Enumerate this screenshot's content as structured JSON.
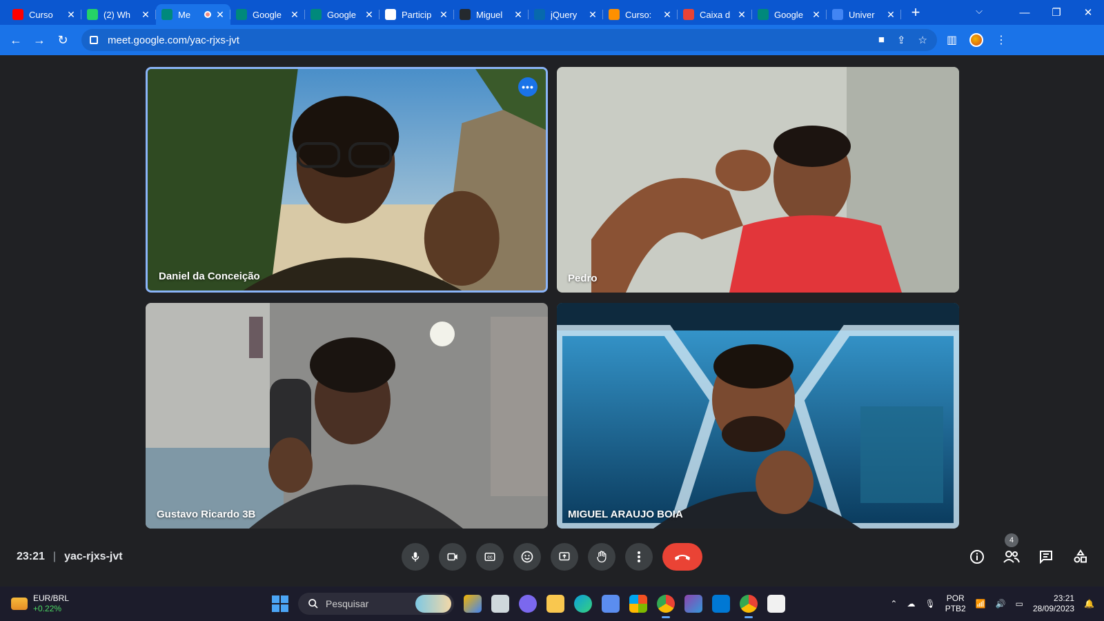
{
  "browser": {
    "tabs": [
      {
        "title": "Curso",
        "icon": "youtube-icon",
        "color": "#ff0000"
      },
      {
        "title": "(2) Wh",
        "icon": "whatsapp-icon",
        "color": "#25d366"
      },
      {
        "title": "Me",
        "icon": "google-meet-icon",
        "color": "#00897b",
        "active": true,
        "recording": true
      },
      {
        "title": "Google",
        "icon": "google-meet-icon",
        "color": "#00897b"
      },
      {
        "title": "Google",
        "icon": "google-meet-icon",
        "color": "#00897b"
      },
      {
        "title": "Particip",
        "icon": "google-icon",
        "color": "#ffffff"
      },
      {
        "title": "Miguel",
        "icon": "github-icon",
        "color": "#24292e"
      },
      {
        "title": "jQuery",
        "icon": "jquery-icon",
        "color": "#0769ad"
      },
      {
        "title": "Curso:",
        "icon": "rocketseat-icon",
        "color": "#ff9000"
      },
      {
        "title": "Caixa d",
        "icon": "gmail-icon",
        "color": "#ea4335"
      },
      {
        "title": "Google",
        "icon": "google-meet-icon",
        "color": "#00897b"
      },
      {
        "title": "Univer",
        "icon": "calendar-icon",
        "color": "#4285f4"
      }
    ],
    "url": "meet.google.com/yac-rjxs-jvt"
  },
  "meeting": {
    "participants": [
      {
        "name": "Daniel da Conceição"
      },
      {
        "name": "Pedro"
      },
      {
        "name": "Gustavo Ricardo 3B"
      },
      {
        "name": "MIGUEL ARAUJO BOIA"
      }
    ],
    "tile_menu_label": "•••",
    "time": "23:21",
    "separator": "|",
    "code": "yac-rjxs-jvt",
    "participant_count": "4",
    "controls": [
      "microphone-icon",
      "camera-icon",
      "captions-icon",
      "emoji-icon",
      "present-icon",
      "raise-hand-icon",
      "more-options-icon",
      "end-call-icon"
    ],
    "right_controls": [
      "info-icon",
      "people-icon",
      "chat-icon",
      "activities-icon"
    ],
    "accent": "#8ab4f8",
    "end_call_color": "#ea4335"
  },
  "taskbar": {
    "ticker_symbol": "EUR/BRL",
    "ticker_change": "+0.22%",
    "search_placeholder": "Pesquisar",
    "lang_top": "POR",
    "lang_bottom": "PTB2",
    "clock_time": "23:21",
    "clock_date": "28/09/2023"
  }
}
